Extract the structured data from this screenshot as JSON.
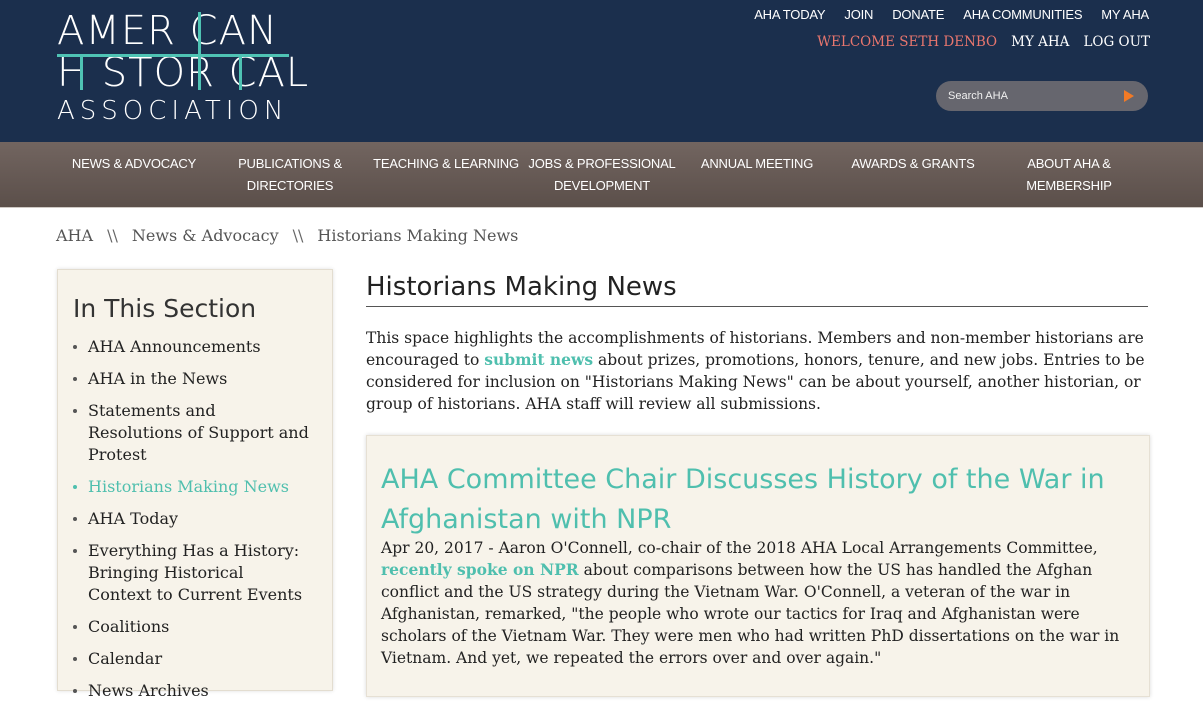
{
  "logo": {
    "line1": "AMER CAN",
    "line2": "H STOR CAL",
    "line3": "ASSOCIATION"
  },
  "topnav": [
    "AHA TODAY",
    "JOIN",
    "DONATE",
    "AHA COMMUNITIES",
    "MY AHA"
  ],
  "usernav": {
    "welcome": "WELCOME SETH DENBO",
    "my_aha": "MY AHA",
    "logout": "LOG OUT"
  },
  "search": {
    "placeholder": "Search AHA"
  },
  "mainnav": [
    "NEWS & ADVOCACY",
    "PUBLICATIONS & DIRECTORIES",
    "TEACHING & LEARNING",
    "JOBS & PROFESSIONAL DEVELOPMENT",
    "ANNUAL MEETING",
    "AWARDS & GRANTS",
    "ABOUT AHA & MEMBERSHIP"
  ],
  "breadcrumb": {
    "home": "AHA",
    "sep": "\\\\",
    "section": "News & Advocacy",
    "current": "Historians Making News"
  },
  "sidebar": {
    "title": "In This Section",
    "items": [
      "AHA Announcements",
      "AHA in the News",
      "Statements and Resolutions of Support and Protest",
      "Historians Making News",
      "AHA Today",
      "Everything Has a History: Bringing Historical Context to Current Events",
      "Coalitions",
      "Calendar",
      "News Archives"
    ],
    "active_index": 3
  },
  "main": {
    "title": "Historians Making News",
    "intro_pre": "This space highlights the accomplishments of historians. Members and non-member historians are encouraged to ",
    "intro_link": "submit news",
    "intro_post": " about prizes, promotions, honors, tenure, and new jobs. Entries to be considered for inclusion on \"Historians Making News\" can be about yourself, another historian, or group of historians. AHA staff will review all submissions."
  },
  "article": {
    "title": "AHA Committee Chair Discusses History of the War in Afghanistan with NPR",
    "lead": "Apr 20, 2017 - Aaron O'Connell, co-chair of the 2018 AHA Local Arrangements Committee, ",
    "link": "recently spoke on NPR",
    "rest": " about comparisons between how the US has handled the Afghan conflict and the US strategy during the Vietnam War. O'Connell, a veteran of the war in Afghanistan, remarked, \"the people who wrote our tactics for Iraq and Afghanistan were scholars of the Vietnam War. They were men who had written PhD dissertations on the war in Vietnam. And yet, we repeated the errors over and over again.\""
  },
  "colors": {
    "header_bg": "#1b2f4d",
    "accent_teal": "#4fbfae",
    "welcome": "#e8766e",
    "search_arrow": "#f27a26",
    "nav_bg": "#6a5d58",
    "panel_bg": "#f7f3ea"
  }
}
